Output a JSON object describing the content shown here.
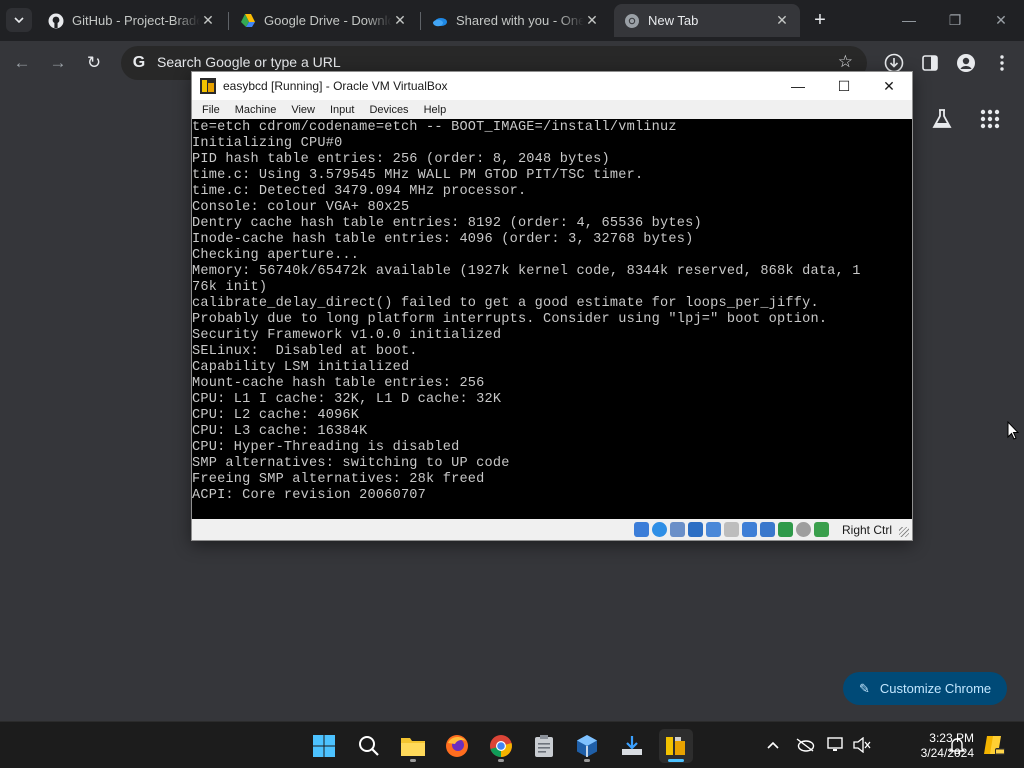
{
  "browser": {
    "tabs": [
      {
        "title": "GitHub - Project-Brade",
        "icon": "github-icon"
      },
      {
        "title": "Google Drive - Downlo",
        "icon": "google-drive-icon"
      },
      {
        "title": "Shared with you - One",
        "icon": "onedrive-icon"
      },
      {
        "title": "New Tab",
        "icon": "chrome-icon",
        "active": true
      }
    ],
    "omnibox": {
      "placeholder": "Search Google or type a URL"
    },
    "customize_label": "Customize Chrome"
  },
  "vbox": {
    "title": "easybcd [Running] - Oracle VM VirtualBox",
    "menu": [
      "File",
      "Machine",
      "View",
      "Input",
      "Devices",
      "Help"
    ],
    "console": "te=etch cdrom/codename=etch -- BOOT_IMAGE=/install/vmlinuz\nInitializing CPU#0\nPID hash table entries: 256 (order: 8, 2048 bytes)\ntime.c: Using 3.579545 MHz WALL PM GTOD PIT/TSC timer.\ntime.c: Detected 3479.094 MHz processor.\nConsole: colour VGA+ 80x25\nDentry cache hash table entries: 8192 (order: 4, 65536 bytes)\nInode-cache hash table entries: 4096 (order: 3, 32768 bytes)\nChecking aperture...\nMemory: 56740k/65472k available (1927k kernel code, 8344k reserved, 868k data, 1\n76k init)\ncalibrate_delay_direct() failed to get a good estimate for loops_per_jiffy.\nProbably due to long platform interrupts. Consider using \"lpj=\" boot option.\nSecurity Framework v1.0.0 initialized\nSELinux:  Disabled at boot.\nCapability LSM initialized\nMount-cache hash table entries: 256\nCPU: L1 I cache: 32K, L1 D cache: 32K\nCPU: L2 cache: 4096K\nCPU: L3 cache: 16384K\nCPU: Hyper-Threading is disabled\nSMP alternatives: switching to UP code\nFreeing SMP alternatives: 28k freed\nACPI: Core revision 20060707",
    "host_key": "Right Ctrl"
  },
  "taskbar": {
    "time": "3:23 PM",
    "date": "3/24/2024"
  },
  "colors": {
    "chrome_bg": "#35363a",
    "tabstrip": "#202124",
    "accent_button": "#004a77",
    "taskbar": "#1c1c1c"
  }
}
